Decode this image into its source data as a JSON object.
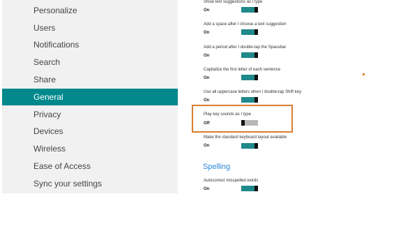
{
  "sidebar": {
    "items": [
      {
        "label": "Personalize",
        "active": false
      },
      {
        "label": "Users",
        "active": false
      },
      {
        "label": "Notifications",
        "active": false
      },
      {
        "label": "Search",
        "active": false
      },
      {
        "label": "Share",
        "active": false
      },
      {
        "label": "General",
        "active": true
      },
      {
        "label": "Privacy",
        "active": false
      },
      {
        "label": "Devices",
        "active": false
      },
      {
        "label": "Wireless",
        "active": false
      },
      {
        "label": "Ease of Access",
        "active": false
      },
      {
        "label": "Sync your settings",
        "active": false
      }
    ],
    "active_color": "#00888c"
  },
  "settings": [
    {
      "label": "Show text suggestions as I type",
      "value": "On",
      "on": true
    },
    {
      "label": "Add a space after I choose a text suggestion",
      "value": "On",
      "on": true
    },
    {
      "label": "Add a period after I double-tap the Spacebar",
      "value": "On",
      "on": true
    },
    {
      "label": "Capitalize the first letter of each sentence",
      "value": "On",
      "on": true
    },
    {
      "label": "Use all uppercase letters when I double-tap Shift key",
      "value": "On",
      "on": true
    },
    {
      "label": "Play key sounds as I type",
      "value": "Off",
      "on": false,
      "highlighted": true
    },
    {
      "label": "Make the standard keyboard layout available",
      "value": "On",
      "on": true
    }
  ],
  "spelling": {
    "heading": "Spelling",
    "settings": [
      {
        "label": "Autocorrect misspelled words",
        "value": "On",
        "on": true
      }
    ]
  },
  "colors": {
    "toggle_on": "#20898b",
    "toggle_off": "#b8b8b8",
    "highlight": "#d87f2c",
    "heading": "#2a86d6"
  }
}
